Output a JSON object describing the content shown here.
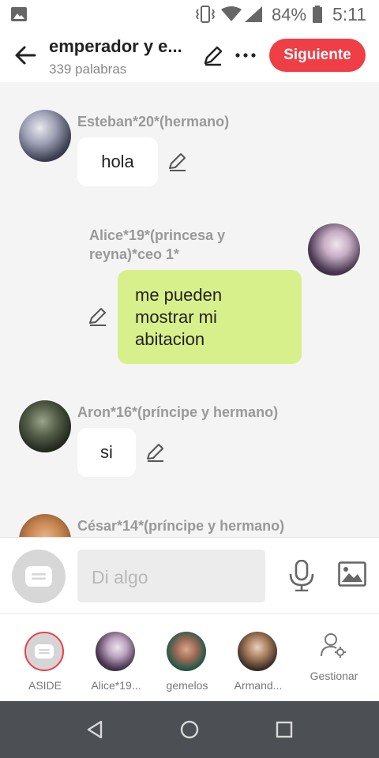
{
  "status_bar": {
    "battery": "84%",
    "time": "5:11",
    "icons": [
      "image-icon",
      "vibrate-icon",
      "wifi-icon",
      "signal-icon",
      "battery-icon"
    ]
  },
  "header": {
    "title": "emperador y e...",
    "word_count": "339 palabras",
    "next_label": "Siguiente",
    "accent_color": "#ef3e46"
  },
  "messages": [
    {
      "sender": "Esteban*20*(hermano)",
      "text": "hola",
      "side": "left"
    },
    {
      "sender": "Alice*19*(princesa y reyna)*ceo 1*",
      "text": "me pueden\nmostrar mi\nabitacion",
      "side": "right",
      "bubble_color": "#d8f08b"
    },
    {
      "sender": "Aron*16*(príncipe y hermano)",
      "text": "si",
      "side": "left"
    },
    {
      "sender": "César*14*(príncipe y hermano)",
      "text": "",
      "side": "left"
    }
  ],
  "input": {
    "placeholder": "Di algo"
  },
  "tabs": [
    {
      "label": "ASIDE"
    },
    {
      "label": "Alice*19..."
    },
    {
      "label": "gemelos"
    },
    {
      "label": "Armand..."
    },
    {
      "label": "Gestionar"
    }
  ],
  "navbar": {
    "icons": [
      "back-triangle-icon",
      "home-circle-icon",
      "recents-square-icon"
    ]
  }
}
